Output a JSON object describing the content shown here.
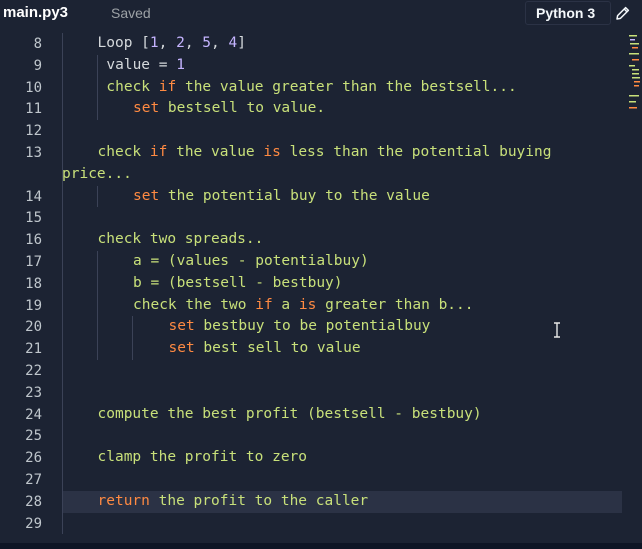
{
  "header": {
    "filename": "main.py3",
    "status": "Saved",
    "language": "Python 3"
  },
  "lines": [
    {
      "n": "8",
      "tokens": [
        [
          "Loop ",
          "plain"
        ],
        [
          "[",
          "plain"
        ],
        [
          "1",
          "num"
        ],
        [
          ", ",
          "plain"
        ],
        [
          "2",
          "num"
        ],
        [
          ", ",
          "plain"
        ],
        [
          "5",
          "num"
        ],
        [
          ", ",
          "plain"
        ],
        [
          "4",
          "num"
        ],
        [
          "]",
          "plain"
        ]
      ],
      "indent": 1
    },
    {
      "n": "9",
      "tokens": [
        [
          "value = ",
          "plain"
        ],
        [
          "1",
          "num"
        ]
      ],
      "indent": 1.25
    },
    {
      "n": "10",
      "tokens": [
        [
          "check ",
          "fn"
        ],
        [
          "if",
          "kw"
        ],
        [
          " the value greater than the bestsell...",
          "fn"
        ]
      ],
      "indent": 1.25
    },
    {
      "n": "11",
      "tokens": [
        [
          "set",
          "kw"
        ],
        [
          " bestsell to value.",
          "fn"
        ]
      ],
      "indent": 2
    },
    {
      "n": "12",
      "tokens": [],
      "indent": 0
    },
    {
      "n": "13",
      "tokens": [
        [
          "check ",
          "fn"
        ],
        [
          "if",
          "kw"
        ],
        [
          " the value ",
          "fn"
        ],
        [
          "is",
          "kw"
        ],
        [
          " less than the potential buying",
          "fn"
        ]
      ],
      "indent": 1
    },
    {
      "n": "",
      "tokens": [
        [
          "price...",
          "fn"
        ]
      ],
      "indent": 0
    },
    {
      "n": "14",
      "tokens": [
        [
          "set",
          "kw"
        ],
        [
          " the potential buy to the value",
          "fn"
        ]
      ],
      "indent": 2
    },
    {
      "n": "15",
      "tokens": [],
      "indent": 0
    },
    {
      "n": "16",
      "tokens": [
        [
          "check two spreads..",
          "fn"
        ]
      ],
      "indent": 1
    },
    {
      "n": "17",
      "tokens": [
        [
          "a = (values - potentialbuy)",
          "fn"
        ]
      ],
      "indent": 2
    },
    {
      "n": "18",
      "tokens": [
        [
          "b = (bestsell - bestbuy)",
          "fn"
        ]
      ],
      "indent": 2
    },
    {
      "n": "19",
      "tokens": [
        [
          "check the two ",
          "fn"
        ],
        [
          "if",
          "kw"
        ],
        [
          " a ",
          "fn"
        ],
        [
          "is",
          "kw"
        ],
        [
          " greater than b...",
          "fn"
        ]
      ],
      "indent": 2
    },
    {
      "n": "20",
      "tokens": [
        [
          "set",
          "kw"
        ],
        [
          " bestbuy to be potentialbuy",
          "fn"
        ]
      ],
      "indent": 3
    },
    {
      "n": "21",
      "tokens": [
        [
          "set",
          "kw"
        ],
        [
          " best sell to value",
          "fn"
        ]
      ],
      "indent": 3
    },
    {
      "n": "22",
      "tokens": [],
      "indent": 0
    },
    {
      "n": "23",
      "tokens": [],
      "indent": 0
    },
    {
      "n": "24",
      "tokens": [
        [
          "compute the best profit (bestsell - bestbuy)",
          "fn"
        ]
      ],
      "indent": 1
    },
    {
      "n": "25",
      "tokens": [],
      "indent": 0
    },
    {
      "n": "26",
      "tokens": [
        [
          "clamp the profit to zero",
          "fn"
        ]
      ],
      "indent": 1
    },
    {
      "n": "27",
      "tokens": [],
      "indent": 0
    },
    {
      "n": "28",
      "tokens": [
        [
          "return",
          "kw"
        ],
        [
          " the profit to the caller",
          "fn"
        ]
      ],
      "indent": 1
    },
    {
      "n": "29",
      "tokens": [],
      "indent": 0
    }
  ],
  "colors": {
    "background": "#1c2333",
    "keyword": "#ff8a42",
    "number": "#c5b4ff",
    "text": "#c8e07a"
  },
  "icons": {
    "edit": "pencil-icon",
    "cursor": "text-cursor-icon"
  }
}
